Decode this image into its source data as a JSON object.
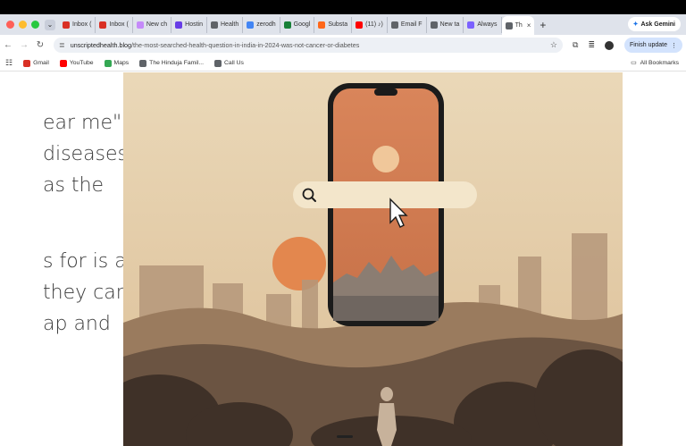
{
  "tabs": [
    {
      "label": "Inbox (",
      "color": "#d93025"
    },
    {
      "label": "Inbox (",
      "color": "#d93025"
    },
    {
      "label": "New ch",
      "color": "#c58af9"
    },
    {
      "label": "Hostin",
      "color": "#673de6"
    },
    {
      "label": "Health",
      "color": "#5f6368"
    },
    {
      "label": "zerodh",
      "color": "#4285f4"
    },
    {
      "label": "Googl",
      "color": "#188038"
    },
    {
      "label": "Substa",
      "color": "#ff6719"
    },
    {
      "label": "(11) ♪)",
      "color": "#ff0000"
    },
    {
      "label": "Email F",
      "color": "#5f6368"
    },
    {
      "label": "New ta",
      "color": "#5f6368"
    },
    {
      "label": "Always",
      "color": "#7b61ff"
    },
    {
      "label": "Th",
      "color": "#5f6368"
    }
  ],
  "tab_close": "×",
  "new_tab": "+",
  "gemini_label": "Ask Gemini",
  "url": {
    "domain": "unscriptedhealth.blog",
    "path": "/the-most-searched-health-question-in-india-in-2024-was-not-cancer-or-diabetes"
  },
  "finish_update": "Finish update",
  "bookmarks": [
    {
      "label": "Gmail",
      "color": "#d93025"
    },
    {
      "label": "YouTube",
      "color": "#ff0000"
    },
    {
      "label": "Maps",
      "color": "#34a853"
    },
    {
      "label": "The Hinduja Famil...",
      "color": "#5f6368"
    },
    {
      "label": "Call Us",
      "color": "#5f6368"
    }
  ],
  "all_bookmarks": "All Bookmarks",
  "article": {
    "lines_a": [
      "ear me\"",
      "diseases",
      "as the"
    ],
    "lines_b": [
      "s for is a",
      "they can",
      "ap and"
    ]
  },
  "colors": {
    "accent": "#1a73e8",
    "sky": "#e7d3b1",
    "sun": "#e3874e",
    "phone_screen": "#d9855a"
  }
}
